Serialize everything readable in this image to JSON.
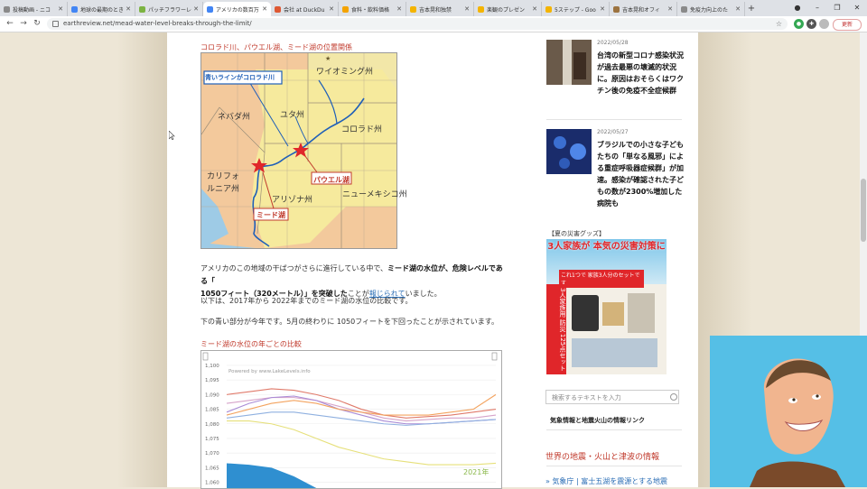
{
  "browser": {
    "tabs": [
      {
        "label": "投稿動画 - ニコ",
        "color": "#8a8a8a"
      },
      {
        "label": "地球の最期のとき",
        "color": "#4285f4"
      },
      {
        "label": "パッチフラワーレメ",
        "color": "#7cb342"
      },
      {
        "label": "アメリカの数百万",
        "color": "#4285f4"
      },
      {
        "label": "会社 at DuckDu",
        "color": "#de5833"
      },
      {
        "label": "食料・飲料価格",
        "color": "#f4a300"
      },
      {
        "label": "吉本晃和独禁",
        "color": "#f4b400"
      },
      {
        "label": "楽観のプレゼン",
        "color": "#f4b400"
      },
      {
        "label": "5ステップ - Goo",
        "color": "#f4b400"
      },
      {
        "label": "吉本晃和オフィ",
        "color": "#9c7340"
      },
      {
        "label": "免疫力向上のた",
        "color": "#8a8a8a"
      }
    ],
    "active_tab": 3,
    "url": "earthreview.net/mead-water-level-breaks-through-the-limit/",
    "update_label": "更新"
  },
  "article": {
    "map_caption": "コロラド川、パウエル湖、ミード湖の位置関係",
    "map_labels": {
      "wyoming": "ワイオミング州",
      "blue_line": "青いラインがコロラド川",
      "nevada": "ネバダ州",
      "utah": "ユタ州",
      "colorado": "コロラド州",
      "california1": "カリフォ",
      "california2": "ルニア州",
      "powell": "パウエル湖",
      "arizona": "アリゾナ州",
      "newmexico": "ニューメキシコ州",
      "mead": "ミード湖"
    },
    "para1_a": "アメリカのこの地域の干ばつがさらに進行している中で、",
    "para1_b": "ミード湖の水位が、危険レベルである「",
    "para1_c": "1050フィート（320メートル）」を突破した",
    "para1_d": "ことが",
    "para1_link": "報じられて",
    "para1_e": "いました。",
    "para2": "以下は、2017年から 2022年までのミード湖の水位の比較です。",
    "para3": "下の青い部分が今年です。5月の終わりに 1050フィートを下回ったことが示されています。",
    "chart_caption": "ミード湖の水位の年ごとの比較"
  },
  "chart_data": {
    "type": "line",
    "credit": "Powered by www.LakeLevels.info",
    "yticks": [
      "1,100",
      "1,095",
      "1,090",
      "1,085",
      "1,080",
      "1,075",
      "1,070",
      "1,065",
      "1,060"
    ],
    "ylim": [
      1058,
      1100
    ],
    "x": [
      0,
      1,
      2,
      3,
      4,
      5,
      6,
      7,
      8,
      9,
      10,
      11,
      12
    ],
    "series": [
      {
        "color": "#e07a6a",
        "values": [
          1090,
          1091,
          1092,
          1091.5,
          1090,
          1088,
          1085,
          1083,
          1082,
          1082.5,
          1083,
          1084,
          1085
        ]
      },
      {
        "color": "#d6a3c9",
        "values": [
          1087,
          1088,
          1089,
          1089,
          1088,
          1086,
          1084,
          1082,
          1081,
          1081.5,
          1082,
          1082,
          1083
        ]
      },
      {
        "color": "#a98bd6",
        "values": [
          1084,
          1087,
          1089,
          1089.5,
          1088,
          1085,
          1083,
          1081,
          1080,
          1080,
          1080.5,
          1081,
          1081.5
        ]
      },
      {
        "color": "#f3a35f",
        "values": [
          1083,
          1085,
          1087,
          1088,
          1087,
          1085,
          1084,
          1083,
          1083,
          1083,
          1084,
          1085,
          1090
        ]
      },
      {
        "color": "#8fb0e0",
        "values": [
          1082,
          1083,
          1084,
          1084,
          1083,
          1082,
          1081,
          1080,
          1079.5,
          1080,
          1080.5,
          1081,
          1081.5
        ]
      },
      {
        "color": "#e6e07a",
        "values": [
          1081,
          1081,
          1080,
          1078,
          1075,
          1072,
          1070,
          1068,
          1067,
          1066,
          1066,
          1066,
          1066.5
        ]
      }
    ],
    "area": {
      "color": "#2f8fd0",
      "values": [
        1066.5,
        1066,
        1065,
        1062,
        1058,
        1058,
        1058,
        1058,
        1058,
        1058,
        1058,
        1058,
        1058
      ]
    },
    "label_2021": "2021年"
  },
  "sidebar": {
    "posts": [
      {
        "date": "2022/05/28",
        "title": "台湾の新型コロナ感染状況が過去最悪の壊滅的状況に。原因はおそらくはワクチン後の免疫不全症候群"
      },
      {
        "date": "2022/05/27",
        "title": "ブラジルでの小さな子どもたちの「単なる風邪」による重症呼吸器症候群」が加速。感染が確認された子どもの数が2300%増加した病院も"
      }
    ],
    "ad_title": "【夏の災害グッズ】",
    "ad_headline": "3人家族が 本気の災害対策に",
    "ad_sub": "これ1つで 家族3人分のセットです",
    "ad_side": "3人家族用 防災 125点セット",
    "search_placeholder": "検索するテキストを入力",
    "link1": "気象情報と地震火山の情報リンク",
    "section_title": "世界の地震・火山と津波の情報",
    "link2": "» 気象庁 | 富士五湖を震源とする地震"
  }
}
